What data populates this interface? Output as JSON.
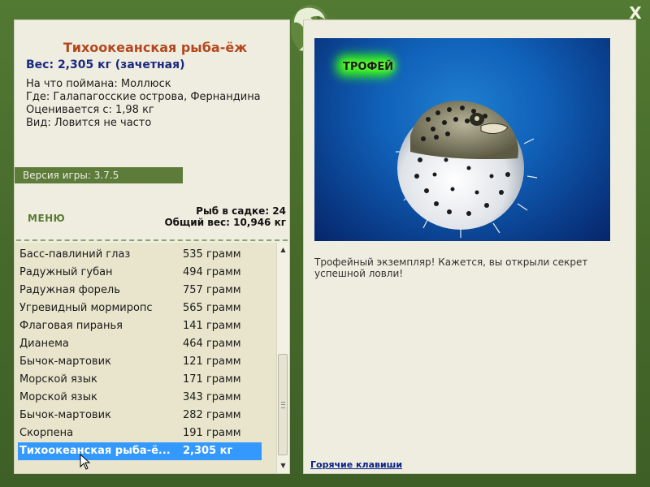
{
  "window": {
    "close_label": "X"
  },
  "fish": {
    "title": "Тихоокеанская рыба-ёж",
    "weight_line": "Вес: 2,305 кг (зачетная)",
    "info": [
      "На что поймана: Моллюск",
      "Где: Галапагосские острова, Фернандина",
      "Оценивается с: 1,98 кг",
      "Вид: Ловится не часто"
    ]
  },
  "version_label": "Версия игры: 3.7.5",
  "menu_label": "МЕНЮ",
  "stats": {
    "count_line": "Рыб в садке: 24",
    "total_line": "Общий вес: 10,946 кг"
  },
  "catch_list": [
    {
      "name": "Басс-павлиний глаз",
      "weight": "535 грамм"
    },
    {
      "name": "Радужный губан",
      "weight": "494 грамм"
    },
    {
      "name": "Радужная форель",
      "weight": "757 грамм"
    },
    {
      "name": "Угревидный мормиропс",
      "weight": "565 грамм"
    },
    {
      "name": "Флаговая пиранья",
      "weight": "141 грамм"
    },
    {
      "name": "Дианема",
      "weight": "464 грамм"
    },
    {
      "name": "Бычок-мартовик",
      "weight": "121 грамм"
    },
    {
      "name": "Морской язык",
      "weight": "171 грамм"
    },
    {
      "name": "Морской язык",
      "weight": "343 грамм"
    },
    {
      "name": "Бычок-мартовик",
      "weight": "282 грамм"
    },
    {
      "name": "Скорпена",
      "weight": "191 грамм"
    },
    {
      "name": "Тихоокеанская рыба-ё...",
      "weight": "2,305 кг",
      "selected": true
    }
  ],
  "photo": {
    "badge": "ТРОФЕЙ"
  },
  "description": "Трофейный экземпляр! Кажется, вы открыли секрет успешной ловли!",
  "hotkeys_label": "Горячие клавиши",
  "colors": {
    "frame": "#4a6b2d",
    "panel": "#efede0",
    "title": "#b3471d",
    "weight": "#1a2a80",
    "selection": "#3399ff",
    "link": "#0a2288"
  }
}
